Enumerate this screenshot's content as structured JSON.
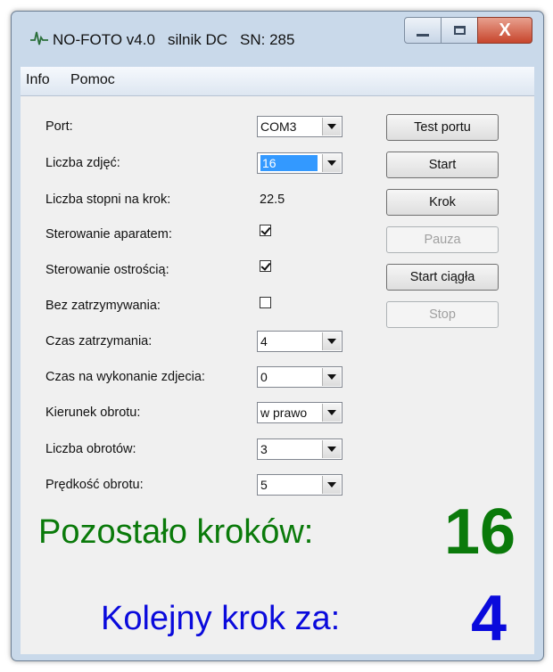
{
  "window": {
    "title_app": "NO-FOTO v4.0",
    "title_motor": "silnik DC",
    "title_sn_label": "SN:",
    "title_sn_value": "285",
    "close_glyph": "X",
    "icon": "waveform-icon"
  },
  "menu": {
    "items": [
      "Info",
      "Pomoc"
    ]
  },
  "form": {
    "port": {
      "label": "Port:",
      "value": "COM3"
    },
    "photos": {
      "label": "Liczba zdjęć:",
      "value": "16"
    },
    "degrees": {
      "label": "Liczba stopni na krok:",
      "value": "22.5"
    },
    "camera_control": {
      "label": "Sterowanie aparatem:",
      "checked": true
    },
    "focus_control": {
      "label": "Sterowanie ostrością:",
      "checked": true
    },
    "no_stop": {
      "label": "Bez zatrzymywania:",
      "checked": false
    },
    "stop_time": {
      "label": "Czas zatrzymania:",
      "value": "4"
    },
    "shot_time": {
      "label": "Czas na wykonanie zdjecia:",
      "value": "0"
    },
    "direction": {
      "label": "Kierunek obrotu:",
      "value": "w prawo"
    },
    "rotations": {
      "label": "Liczba obrotów:",
      "value": "3"
    },
    "speed": {
      "label": "Prędkość obrotu:",
      "value": "5"
    }
  },
  "buttons": {
    "test_port": "Test portu",
    "start": "Start",
    "step": "Krok",
    "pause": "Pauza",
    "continuous": "Start ciągła",
    "stop": "Stop"
  },
  "status": {
    "remaining_label": "Pozostało kroków:",
    "remaining_value": "16",
    "next_label": "Kolejny krok za:",
    "next_value": "4"
  },
  "colors": {
    "remaining": "#0a7a0a",
    "next": "#0a0adc",
    "selection": "#3399ff"
  }
}
